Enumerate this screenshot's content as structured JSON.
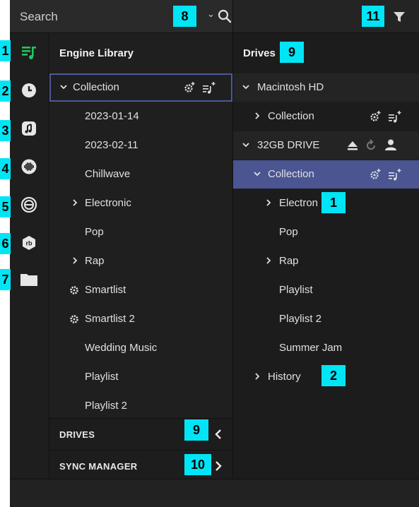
{
  "search": {
    "placeholder": "Search"
  },
  "library": {
    "title": "Engine Library",
    "items": [
      {
        "label": "Collection"
      },
      {
        "label": "2023-01-14"
      },
      {
        "label": "2023-02-11"
      },
      {
        "label": "Chillwave"
      },
      {
        "label": "Electronic"
      },
      {
        "label": "Pop"
      },
      {
        "label": "Rap"
      },
      {
        "label": "Smartlist"
      },
      {
        "label": "Smartlist 2"
      },
      {
        "label": "Wedding Music"
      },
      {
        "label": "Playlist"
      },
      {
        "label": "Playlist 2"
      }
    ],
    "footer": {
      "drives": "DRIVES",
      "sync": "SYNC MANAGER"
    }
  },
  "drives": {
    "title": "Drives",
    "items": [
      {
        "label": "Macintosh HD"
      },
      {
        "label": "Collection"
      },
      {
        "label": "32GB DRIVE"
      },
      {
        "label": "Collection"
      },
      {
        "label": "Electron"
      },
      {
        "label": "Pop"
      },
      {
        "label": "Rap"
      },
      {
        "label": "Playlist"
      },
      {
        "label": "Playlist 2"
      },
      {
        "label": "Summer Jam"
      },
      {
        "label": "History"
      }
    ]
  },
  "callouts": [
    "1",
    "2",
    "3",
    "4",
    "5",
    "6",
    "7",
    "8",
    "9",
    "9",
    "10",
    "11",
    "1",
    "2"
  ],
  "colors": {
    "accent_green": "#22c55e",
    "selection": "#4a5592",
    "callout": "#00e5f5"
  }
}
